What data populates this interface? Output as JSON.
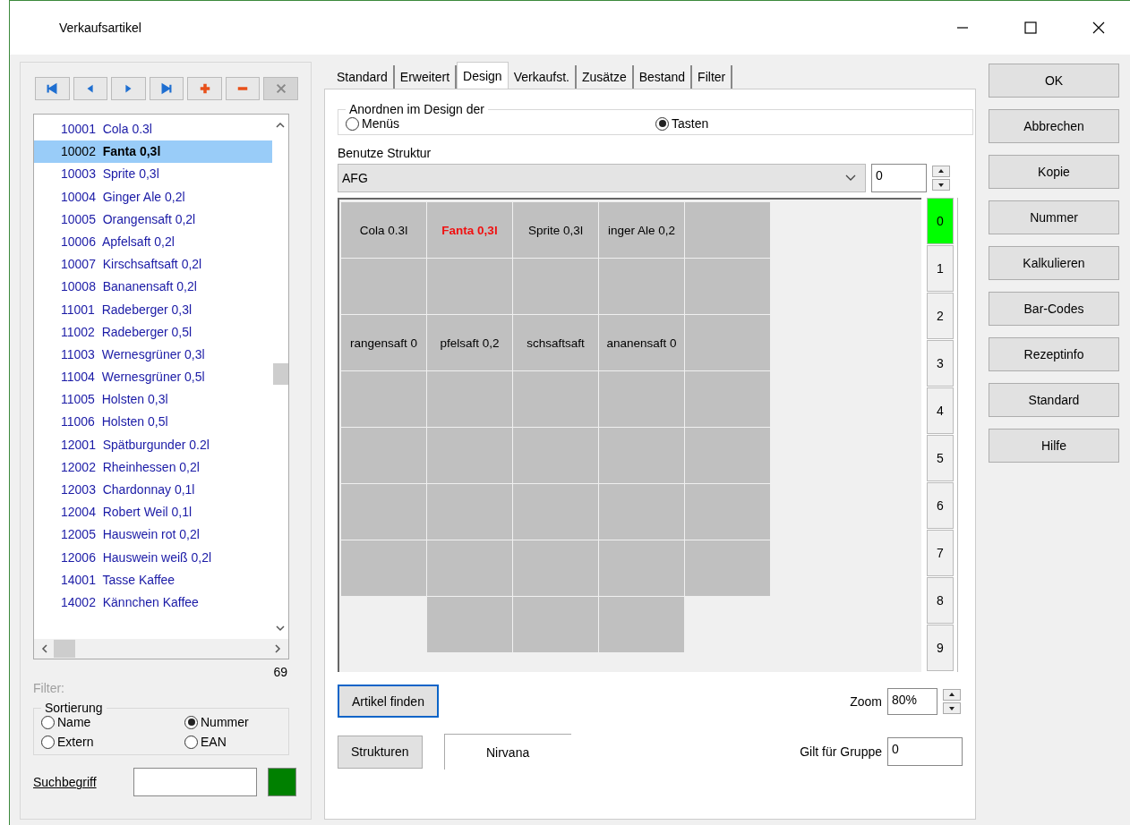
{
  "window": {
    "title": "Verkaufsartikel"
  },
  "toolbar": [
    {
      "kind": "first",
      "disabled": false
    },
    {
      "kind": "prev",
      "disabled": false
    },
    {
      "kind": "next",
      "disabled": false
    },
    {
      "kind": "last",
      "disabled": false
    },
    {
      "kind": "add",
      "disabled": false
    },
    {
      "kind": "remove",
      "disabled": false
    },
    {
      "kind": "delete",
      "disabled": true
    }
  ],
  "articles": [
    {
      "number": "10001",
      "name": "Cola 0.3l",
      "selected": false
    },
    {
      "number": "10002",
      "name": "Fanta 0,3l",
      "selected": true
    },
    {
      "number": "10003",
      "name": "Sprite 0,3l",
      "selected": false
    },
    {
      "number": "10004",
      "name": "Ginger Ale 0,2l",
      "selected": false
    },
    {
      "number": "10005",
      "name": "Orangensaft 0,2l",
      "selected": false
    },
    {
      "number": "10006",
      "name": "Apfelsaft 0,2l",
      "selected": false
    },
    {
      "number": "10007",
      "name": "Kirschsaftsaft 0,2l",
      "selected": false
    },
    {
      "number": "10008",
      "name": "Bananensaft 0,2l",
      "selected": false
    },
    {
      "number": "11001",
      "name": "Radeberger 0,3l",
      "selected": false
    },
    {
      "number": "11002",
      "name": "Radeberger 0,5l",
      "selected": false
    },
    {
      "number": "11003",
      "name": "Wernesgrüner 0,3l",
      "selected": false
    },
    {
      "number": "11004",
      "name": "Wernesgrüner 0,5l",
      "selected": false
    },
    {
      "number": "11005",
      "name": "Holsten 0,3l",
      "selected": false
    },
    {
      "number": "11006",
      "name": "Holsten 0,5l",
      "selected": false
    },
    {
      "number": "12001",
      "name": "Spätburgunder 0.2l",
      "selected": false
    },
    {
      "number": "12002",
      "name": "Rheinhessen 0,2l",
      "selected": false
    },
    {
      "number": "12003",
      "name": "Chardonnay 0,1l",
      "selected": false
    },
    {
      "number": "12004",
      "name": "Robert Weil 0,1l",
      "selected": false
    },
    {
      "number": "12005",
      "name": "Hauswein rot 0,2l",
      "selected": false
    },
    {
      "number": "12006",
      "name": "Hauswein weiß 0,2l",
      "selected": false
    },
    {
      "number": "14001",
      "name": "Tasse Kaffee",
      "selected": false
    },
    {
      "number": "14002",
      "name": "Kännchen Kaffee",
      "selected": false
    }
  ],
  "count": "69",
  "filter_label": "Filter:",
  "sort": {
    "title": "Sortierung",
    "options": [
      {
        "label": "Name",
        "selected": false
      },
      {
        "label": "Nummer",
        "selected": true
      },
      {
        "label": "Extern",
        "selected": false
      },
      {
        "label": "EAN",
        "selected": false
      }
    ]
  },
  "search": {
    "label": "Suchbegriff",
    "color": "#008000"
  },
  "tabs": [
    {
      "label": "Standard",
      "selected": false
    },
    {
      "label": "Erweitert",
      "selected": false
    },
    {
      "label": "Design",
      "selected": true
    },
    {
      "label": "Verkaufst.",
      "selected": false
    },
    {
      "label": "Zusätze",
      "selected": false
    },
    {
      "label": "Bestand",
      "selected": false
    },
    {
      "label": "Filter",
      "selected": false
    }
  ],
  "arrange": {
    "title": "Anordnen im Design der",
    "options": [
      {
        "label": "Menüs",
        "selected": false
      },
      {
        "label": "Tasten",
        "selected": true
      }
    ]
  },
  "structure": {
    "label": "Benutze Struktur",
    "value": "AFG",
    "number": "0"
  },
  "grid": [
    [
      {
        "kind": "key",
        "label": "Cola 0.3l",
        "current": false
      },
      {
        "kind": "key",
        "label": "Fanta 0,3l",
        "current": true
      },
      {
        "kind": "key",
        "label": "Sprite 0,3l",
        "current": false
      },
      {
        "kind": "key",
        "label": "inger Ale 0,2",
        "current": false
      },
      {
        "kind": "key"
      }
    ],
    [
      {
        "kind": "key"
      },
      {
        "kind": "key"
      },
      {
        "kind": "key"
      },
      {
        "kind": "key"
      },
      {
        "kind": "key"
      }
    ],
    [
      {
        "kind": "key",
        "label": "rangensaft 0",
        "current": false
      },
      {
        "kind": "key",
        "label": "pfelsaft 0,2",
        "current": false
      },
      {
        "kind": "key",
        "label": "schsaftsaft",
        "current": false
      },
      {
        "kind": "key",
        "label": "ananensaft 0",
        "current": false
      },
      {
        "kind": "key"
      }
    ],
    [
      {
        "kind": "key"
      },
      {
        "kind": "key"
      },
      {
        "kind": "key"
      },
      {
        "kind": "key"
      },
      {
        "kind": "key"
      }
    ],
    [
      {
        "kind": "key"
      },
      {
        "kind": "key"
      },
      {
        "kind": "key"
      },
      {
        "kind": "key"
      },
      {
        "kind": "key"
      }
    ],
    [
      {
        "kind": "key"
      },
      {
        "kind": "key"
      },
      {
        "kind": "key"
      },
      {
        "kind": "key"
      },
      {
        "kind": "key"
      }
    ],
    [
      {
        "kind": "key"
      },
      {
        "kind": "key"
      },
      {
        "kind": "key"
      },
      {
        "kind": "key"
      },
      {
        "kind": "key"
      }
    ],
    [
      {
        "kind": "gap"
      },
      {
        "kind": "key"
      },
      {
        "kind": "key"
      },
      {
        "kind": "key"
      },
      {
        "kind": "gap"
      }
    ]
  ],
  "pages": [
    {
      "label": "0",
      "selected": true
    },
    {
      "label": "1",
      "selected": false
    },
    {
      "label": "2",
      "selected": false
    },
    {
      "label": "3",
      "selected": false
    },
    {
      "label": "4",
      "selected": false
    },
    {
      "label": "5",
      "selected": false
    },
    {
      "label": "6",
      "selected": false
    },
    {
      "label": "7",
      "selected": false
    },
    {
      "label": "8",
      "selected": false
    },
    {
      "label": "9",
      "selected": false
    }
  ],
  "find_button": "Artikel finden",
  "zoom": {
    "label": "Zoom",
    "value": "80%"
  },
  "structures_button": "Strukturen",
  "structure_name": "Nirvana",
  "group": {
    "label": "Gilt für Gruppe",
    "value": "0"
  },
  "buttons": [
    "OK",
    "Abbrechen",
    "Kopie",
    "Nummer",
    "Kalkulieren",
    "Bar-Codes",
    "Rezeptinfo",
    "Standard",
    "Hilfe"
  ]
}
